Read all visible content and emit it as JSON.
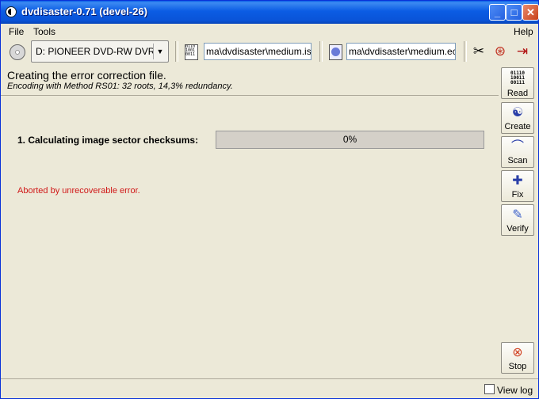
{
  "window": {
    "title": "dvdisaster-0.71 (devel-26)",
    "minimize_glyph": "_",
    "maximize_glyph": "□",
    "close_glyph": "✕"
  },
  "menu": {
    "file": "File",
    "tools": "Tools",
    "help": "Help"
  },
  "toolbar": {
    "drive_value": "D: PIONEER DVD-RW DVR-K",
    "image_file": "ma\\dvdisaster\\medium.iso",
    "ecc_file": "ma\\dvdisaster\\medium.ecc",
    "icons": [
      "drive-icon",
      "image-file-icon",
      "ecc-file-icon",
      "preferences-icon",
      "help-lifebuoy-icon",
      "quit-icon"
    ]
  },
  "status": {
    "main": "Creating the error correction file.",
    "sub": "Encoding with Method RS01: 32 roots, 14,3% redundancy."
  },
  "task": {
    "label": "1. Calculating image sector checksums:",
    "progress_text": "0%",
    "progress_fraction": 0.0,
    "error": "Aborted by unrecoverable error."
  },
  "sidebar": {
    "read": "Read",
    "read_icon_text": "01110\n10011\n00111",
    "create": "Create",
    "scan": "Scan",
    "fix": "Fix",
    "verify": "Verify",
    "stop": "Stop"
  },
  "footer": {
    "view_log": "View log"
  },
  "colors": {
    "titlebar": "#0a54d8",
    "error": "#d01818",
    "background": "#ece9d8"
  }
}
